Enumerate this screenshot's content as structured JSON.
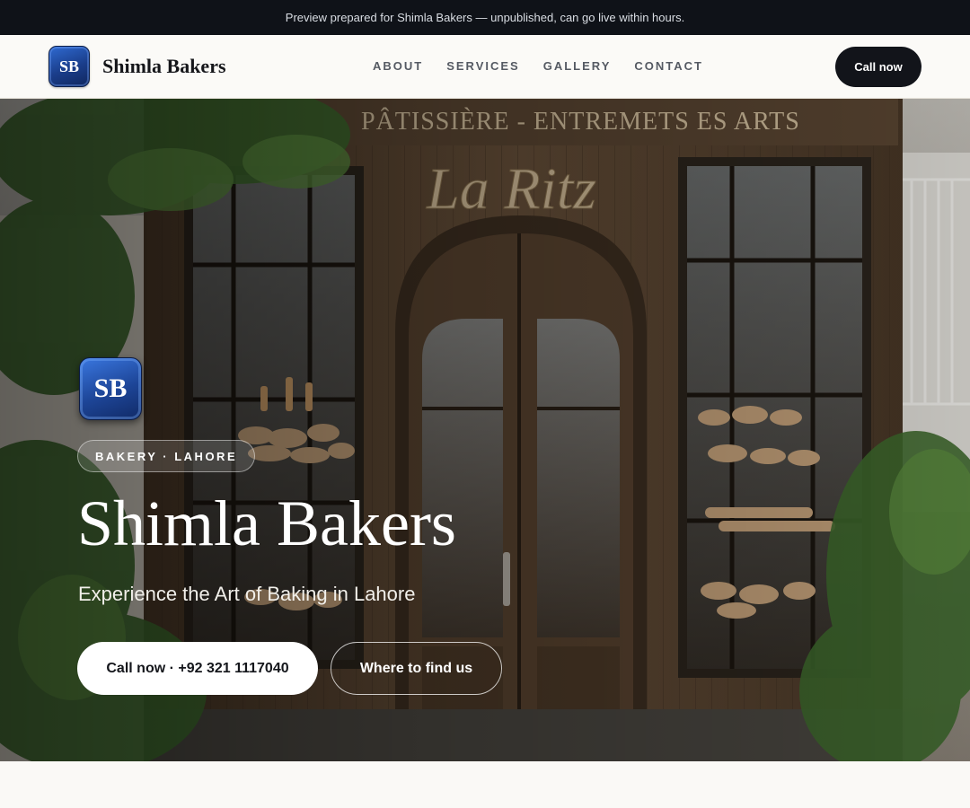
{
  "banner": {
    "text": "Preview prepared for Shimla Bakers — unpublished, can go live within hours."
  },
  "header": {
    "logo_text": "SB",
    "brand": "Shimla Bakers",
    "nav": [
      "ABOUT",
      "SERVICES",
      "GALLERY",
      "CONTACT"
    ],
    "cta": "Call now"
  },
  "hero": {
    "storefront_sign": "La Ritz",
    "storefront_banner": "Pâtissière - Entremets   es Arts",
    "logo_text": "SB",
    "tag": "BAKERY · LAHORE",
    "title": "Shimla Bakers",
    "subtitle": "Experience the Art of Baking in Lahore",
    "primary_button": "Call now · +92 321 1117040",
    "secondary_button": "Where to find us"
  },
  "colors": {
    "banner_bg": "#0f1218",
    "dark_button": "#12141a",
    "logo_blue": "#1d4597",
    "wood": "#5a4532"
  }
}
